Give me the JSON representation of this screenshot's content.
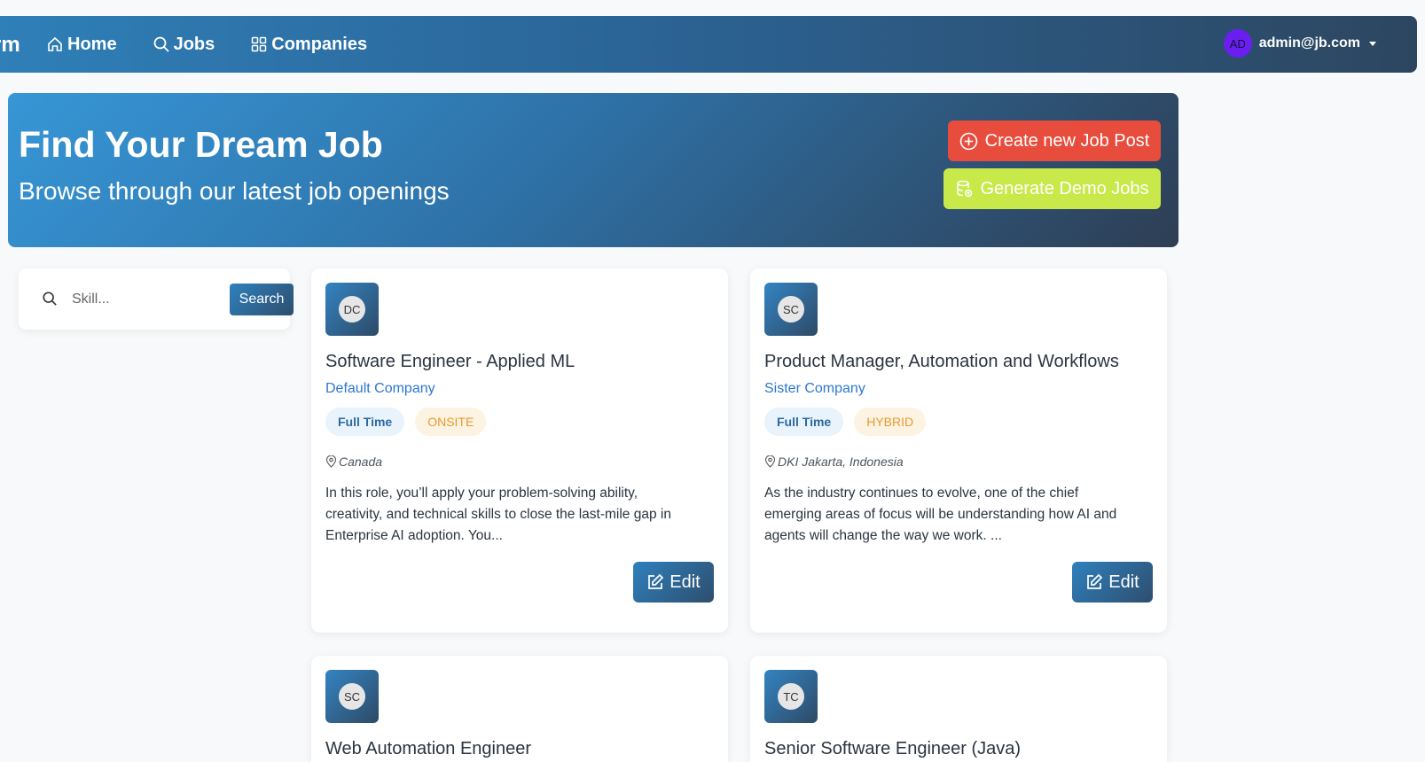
{
  "navbar": {
    "brand": "rm",
    "links": [
      {
        "label": "Home",
        "icon": "home-icon"
      },
      {
        "label": "Jobs",
        "icon": "search-icon"
      },
      {
        "label": "Companies",
        "icon": "grid-icon"
      }
    ],
    "user": {
      "initials": "AD",
      "email": "admin@jb.com"
    }
  },
  "hero": {
    "title": "Find Your Dream Job",
    "subtitle": "Browse through our latest job openings",
    "create_label": "Create new Job Post",
    "demo_label": "Generate Demo Jobs"
  },
  "search": {
    "placeholder": "Skill...",
    "button_label": "Search"
  },
  "jobs": [
    {
      "initials": "DC",
      "title": "Software Engineer - Applied ML",
      "company": "Default Company",
      "type": "Full Time",
      "mode": "ONSITE",
      "location": "Canada",
      "description": "In this role, you’ll apply your problem-solving ability, creativity, and technical skills to close the last-mile gap in Enterprise AI adoption. You...",
      "edit_label": "Edit"
    },
    {
      "initials": "SC",
      "title": "Product Manager, Automation and Workflows",
      "company": "Sister Company",
      "type": "Full Time",
      "mode": "HYBRID",
      "location": "DKI Jakarta, Indonesia",
      "description": "As the industry continues to evolve, one of the chief emerging areas of focus will be understanding how AI and agents will change the way we work. ...",
      "edit_label": "Edit"
    },
    {
      "initials": "SC",
      "title": "Web Automation Engineer"
    },
    {
      "initials": "TC",
      "title": "Senior Software Engineer (Java)"
    }
  ],
  "colors": {
    "accent": "#2e72a8",
    "create_button": "#e74c3c",
    "demo_button": "#c9e84a",
    "link": "#2d77d0",
    "tag_onsite": "#e89a2a",
    "avatar": "#6a1ff0"
  }
}
